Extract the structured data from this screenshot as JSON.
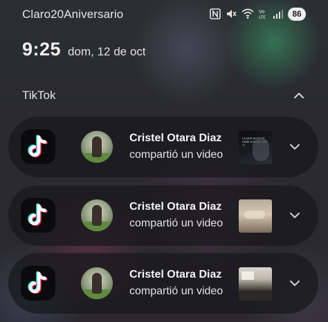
{
  "status_bar": {
    "carrier": "Claro20Aniversario",
    "battery": "86",
    "network_label": "Vo LTE",
    "icons": [
      "nfc-icon",
      "mute-icon",
      "wifi-icon",
      "volte-icon",
      "signal-icon",
      "battery-icon"
    ]
  },
  "header": {
    "time": "9:25",
    "date": "dom, 12 de oct"
  },
  "group": {
    "app_name": "TikTok",
    "collapse_icon": "chevron-up-icon"
  },
  "notifications": [
    {
      "app_icon": "tiktok-icon",
      "sender": "Cristel Otara Diaz",
      "message": "compartió un video",
      "thumb_caption": "LA QUE ALGO TE SABE A NADA / SIN TI",
      "expand_icon": "chevron-down-icon"
    },
    {
      "app_icon": "tiktok-icon",
      "sender": "Cristel Otara Diaz",
      "message": "compartió un video",
      "expand_icon": "chevron-down-icon"
    },
    {
      "app_icon": "tiktok-icon",
      "sender": "Cristel Otara Diaz",
      "message": "compartió un video",
      "expand_icon": "chevron-down-icon"
    }
  ],
  "colors": {
    "tiktok_cyan": "#25F4EE",
    "tiktok_red": "#FE2C55",
    "card_bg": "#18181c"
  }
}
